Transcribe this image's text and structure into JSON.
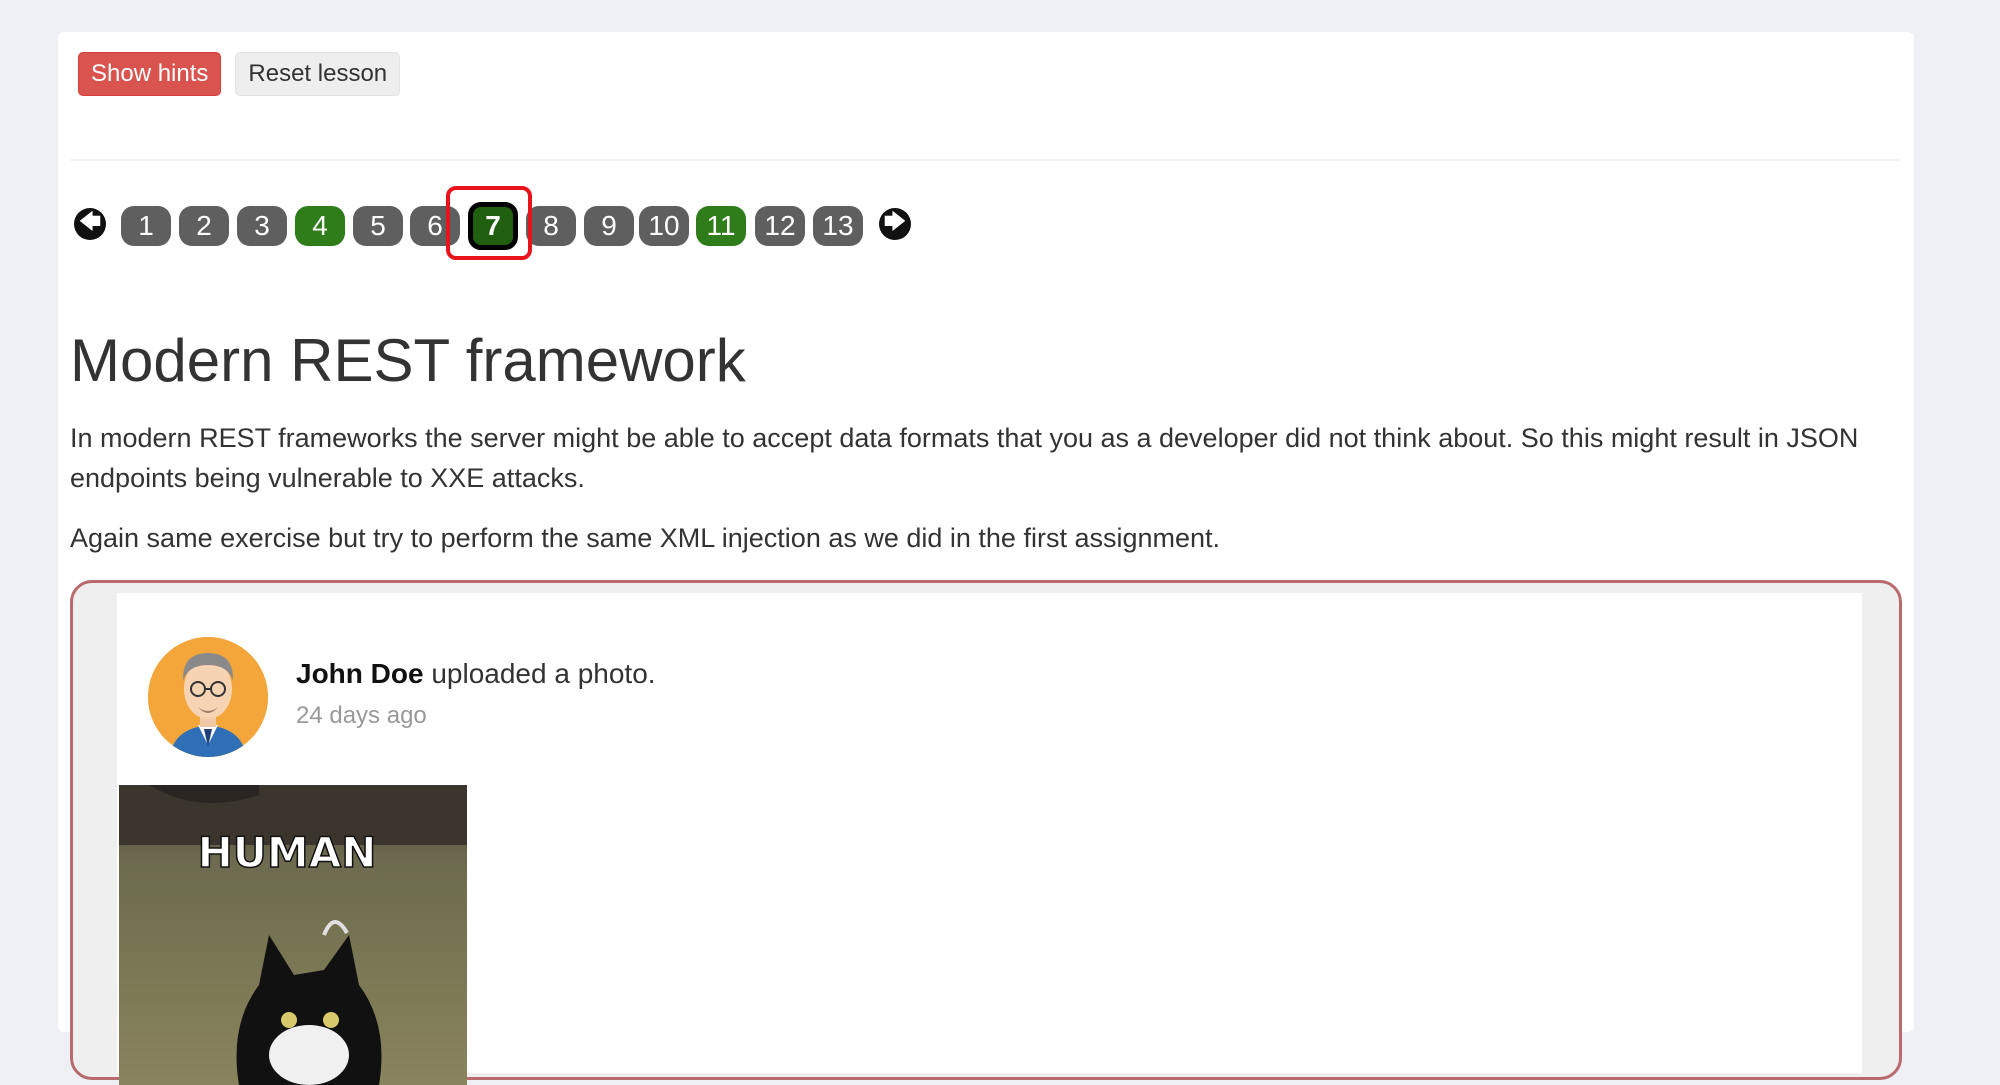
{
  "toolbar": {
    "show_hints_label": "Show hints",
    "reset_lesson_label": "Reset lesson"
  },
  "pagination": {
    "current": 7,
    "solved": [
      4,
      7,
      11
    ],
    "pages": [
      "1",
      "2",
      "3",
      "4",
      "5",
      "6",
      "7",
      "8",
      "9",
      "10",
      "11",
      "12",
      "13"
    ],
    "prev_icon": "arrow-left-circle-icon",
    "next_icon": "arrow-right-circle-icon"
  },
  "lesson": {
    "title": "Modern REST framework",
    "paragraph1": "In modern REST frameworks the server might be able to accept data formats that you as a developer did not think about. So this might result in JSON endpoints being vulnerable to XXE attacks.",
    "paragraph2": "Again same exercise but try to perform the same XML injection as we did in the first assignment."
  },
  "post": {
    "author": "John Doe",
    "action": " uploaded a photo.",
    "time": "24 days ago",
    "image_caption": "HUMAN"
  },
  "colors": {
    "danger": "#d9534f",
    "solved": "#2e7d1a",
    "highlight": "#e8141c",
    "assignment_border": "#b86a6e"
  }
}
